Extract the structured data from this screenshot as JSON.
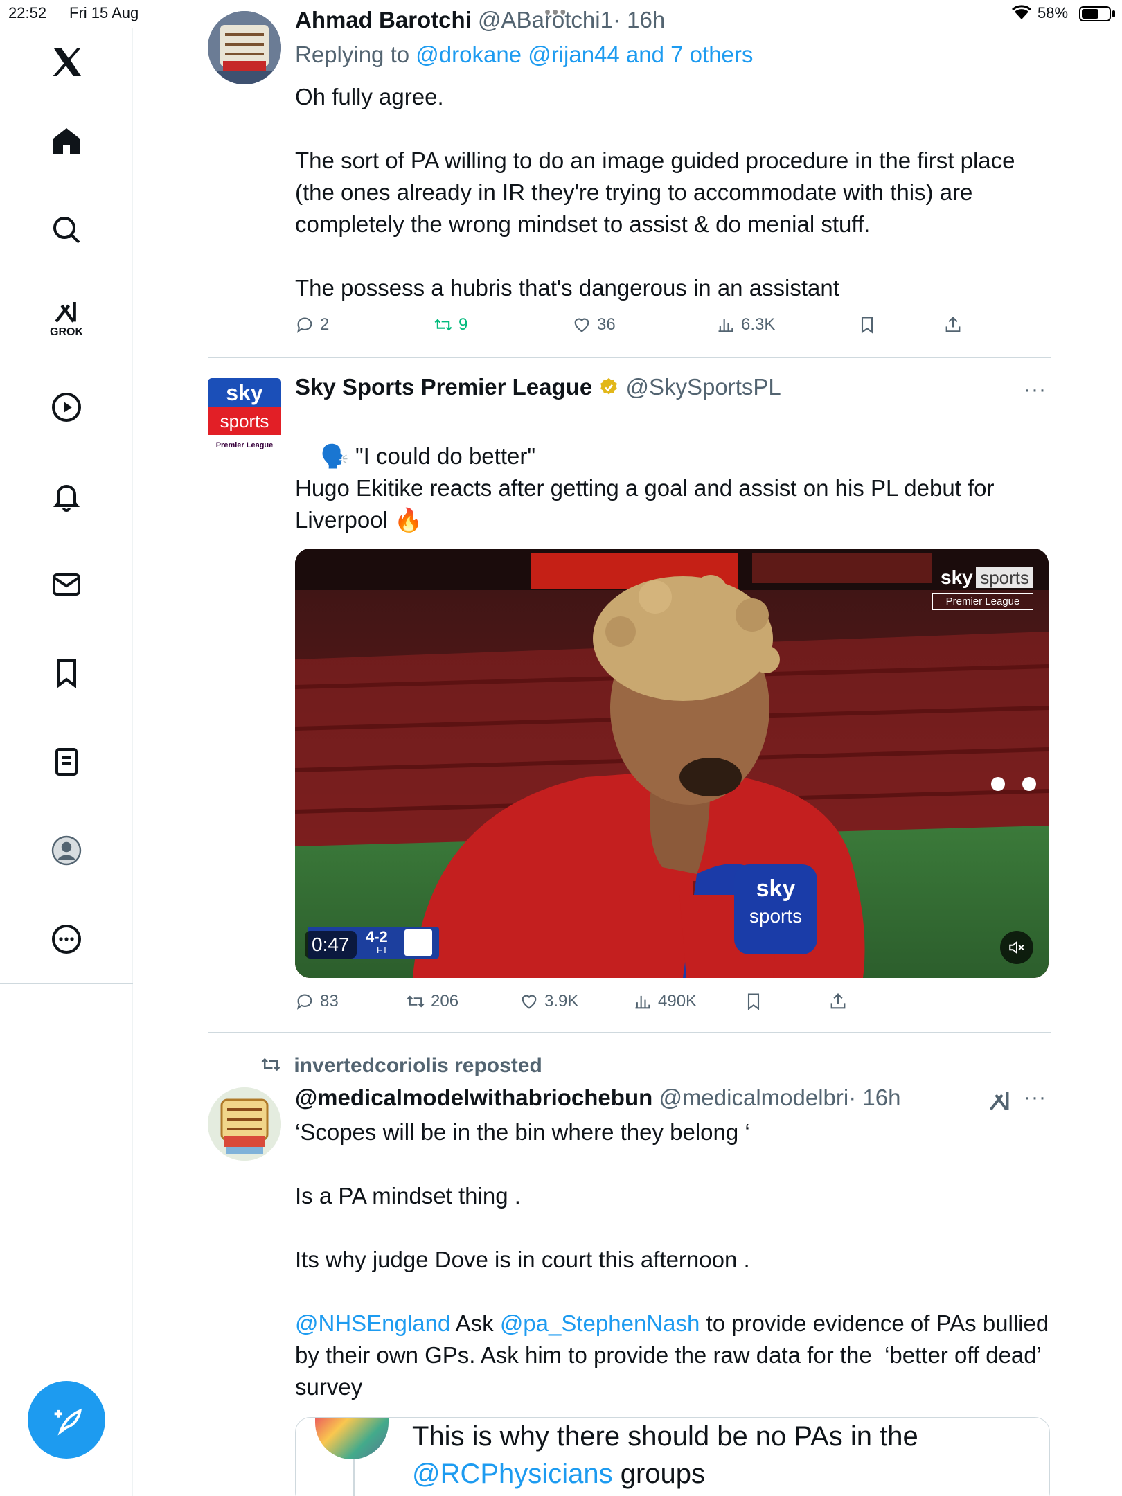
{
  "status_bar": {
    "time": "22:52",
    "date": "Fri 15 Aug",
    "battery": "58%"
  },
  "sidebar": {
    "grok_label": "GROK",
    "icons": [
      "x-logo-icon",
      "home-icon",
      "search-icon",
      "grok-icon",
      "video-icon",
      "bell-icon",
      "mail-icon",
      "bookmark-icon",
      "lists-icon",
      "profile-icon",
      "more-icon"
    ]
  },
  "tweets": [
    {
      "name": "Ahmad Barotchi",
      "handle": "@ABarotchi1",
      "time": "· 16h",
      "reply_prefix": "Replying to ",
      "reply_to": "@drokane @rijan44 and 7 others",
      "text": "Oh fully agree.\n\nThe sort of PA willing to do an image guided procedure in the first place (the ones already in IR they're trying to accommodate with this) are completely the wrong mindset to assist & do menial stuff.\n\nThe possess a hubris that's dangerous in an assistant",
      "replies": "2",
      "reposts": "9",
      "likes": "36",
      "views": "6.3K"
    },
    {
      "name": "Sky Sports Premier League",
      "handle": "@SkySportsPL",
      "avatar_top": "sky",
      "avatar_mid": "sports",
      "avatar_bottom": "Premier League",
      "text_line1": "\"I could do better\"",
      "text_rest": "Hugo Ekitike reacts after getting a goal and assist on his PL debut for Liverpool 🔥",
      "video": {
        "duration": "0:47",
        "score": "4-2",
        "score_status": "FT",
        "brand_top": "sky",
        "brand_right": "sports",
        "brand_sub": "Premier League",
        "mic_top": "sky",
        "mic_bottom": "sports"
      },
      "replies": "83",
      "reposts": "206",
      "likes": "3.9K",
      "views": "490K"
    },
    {
      "repost_label": "invertedcoriolis reposted",
      "name": "@medicalmodelwithabriochebun",
      "handle": "@medicalmodelbri",
      "time": "· 16h",
      "line1": "‘Scopes will be in the bin where they belong ‘",
      "line2": "Is a PA mindset thing .",
      "line3": "Its why judge Dove is in court this afternoon .",
      "mention1": "@NHSEngland",
      "mid1": " Ask ",
      "mention2": "@pa_StephenNash",
      "rest": " to provide evidence of PAs bullied by their own GPs. Ask him to provide the raw data for the  ‘better off dead’ survey",
      "quote_line1": "This is why there should be no PAs in the",
      "quote_mention": "@RCPhysicians",
      "quote_tail": " groups"
    }
  ],
  "colors": {
    "accent": "#1d9bf0",
    "repost_green": "#00ba7c",
    "muted": "#536471"
  }
}
